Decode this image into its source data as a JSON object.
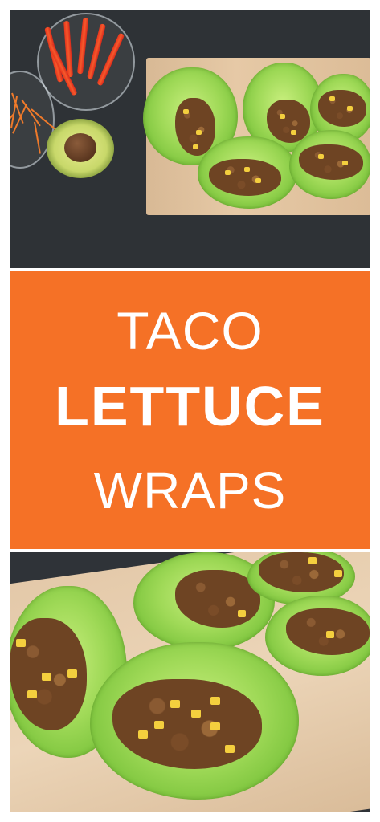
{
  "banner": {
    "line1": "TACO",
    "line2": "LETTUCE",
    "line3": "WRAPS",
    "background_color": "#f57126",
    "text_color": "#ffffff"
  },
  "photos": {
    "top": "overhead-lettuce-wraps-with-peppers-carrots-avocado",
    "bottom": "close-up-lettuce-wraps-on-cutting-board"
  }
}
